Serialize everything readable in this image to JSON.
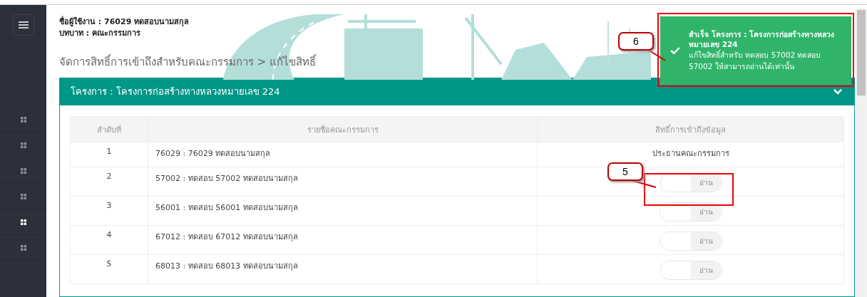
{
  "sidebar": {
    "items": [
      {
        "selected": false
      },
      {
        "selected": false
      },
      {
        "selected": false
      },
      {
        "selected": false
      },
      {
        "selected": true
      },
      {
        "selected": false
      }
    ]
  },
  "header": {
    "user": "ชื่อผู้ใช้งาน : 76029 ทดสอบนามสกุล",
    "role": "บทบาท : คณะกรรมการ",
    "breadcrumb": "จัดการสิทธิ์การเข้าถึงสำหรับคณะกรรมการ > แก้ไขสิทธิ์"
  },
  "panel": {
    "title": "โครงการ : โครงการก่อสร้างทางหลวงหมายเลข 224",
    "expanded": true
  },
  "table": {
    "columns": [
      "ลำดับที่",
      "รายชื่อคณะกรรมการ",
      "สิทธิ์การเข้าถึงข้อมูล"
    ],
    "rows": [
      {
        "no": "1",
        "name": "76029 : 76029 ทดสอบนามสกุล",
        "kind": "text",
        "access": "ประธานคณะกรรมการ"
      },
      {
        "no": "2",
        "name": "57002 : ทดสอบ 57002 ทดสอบนามสกุล",
        "kind": "toggle",
        "access": "อ่าน",
        "on": false
      },
      {
        "no": "3",
        "name": "56001 : ทดสอบ 56001 ทดสอบนามสกุล",
        "kind": "toggle",
        "access": "อ่าน",
        "on": false
      },
      {
        "no": "4",
        "name": "67012 : ทดสอบ 67012 ทดสอบนามสกุล",
        "kind": "toggle",
        "access": "อ่าน",
        "on": false
      },
      {
        "no": "5",
        "name": "68013 : ทดสอบ 68013 ทดสอบนามสกุล",
        "kind": "toggle",
        "access": "อ่าน",
        "on": false
      }
    ]
  },
  "toast": {
    "title": "สำเร็จ โครงการ : โครงการก่อสร้างทางหลวงหมายเลข 224",
    "message": "แก้ไขสิทธิ์สำหรับ ทดสอบ 57002 ทดสอบ 57002 ให้สามารถอ่านได้เท่านั้น"
  },
  "callouts": [
    {
      "label": "5"
    },
    {
      "label": "6"
    }
  ]
}
